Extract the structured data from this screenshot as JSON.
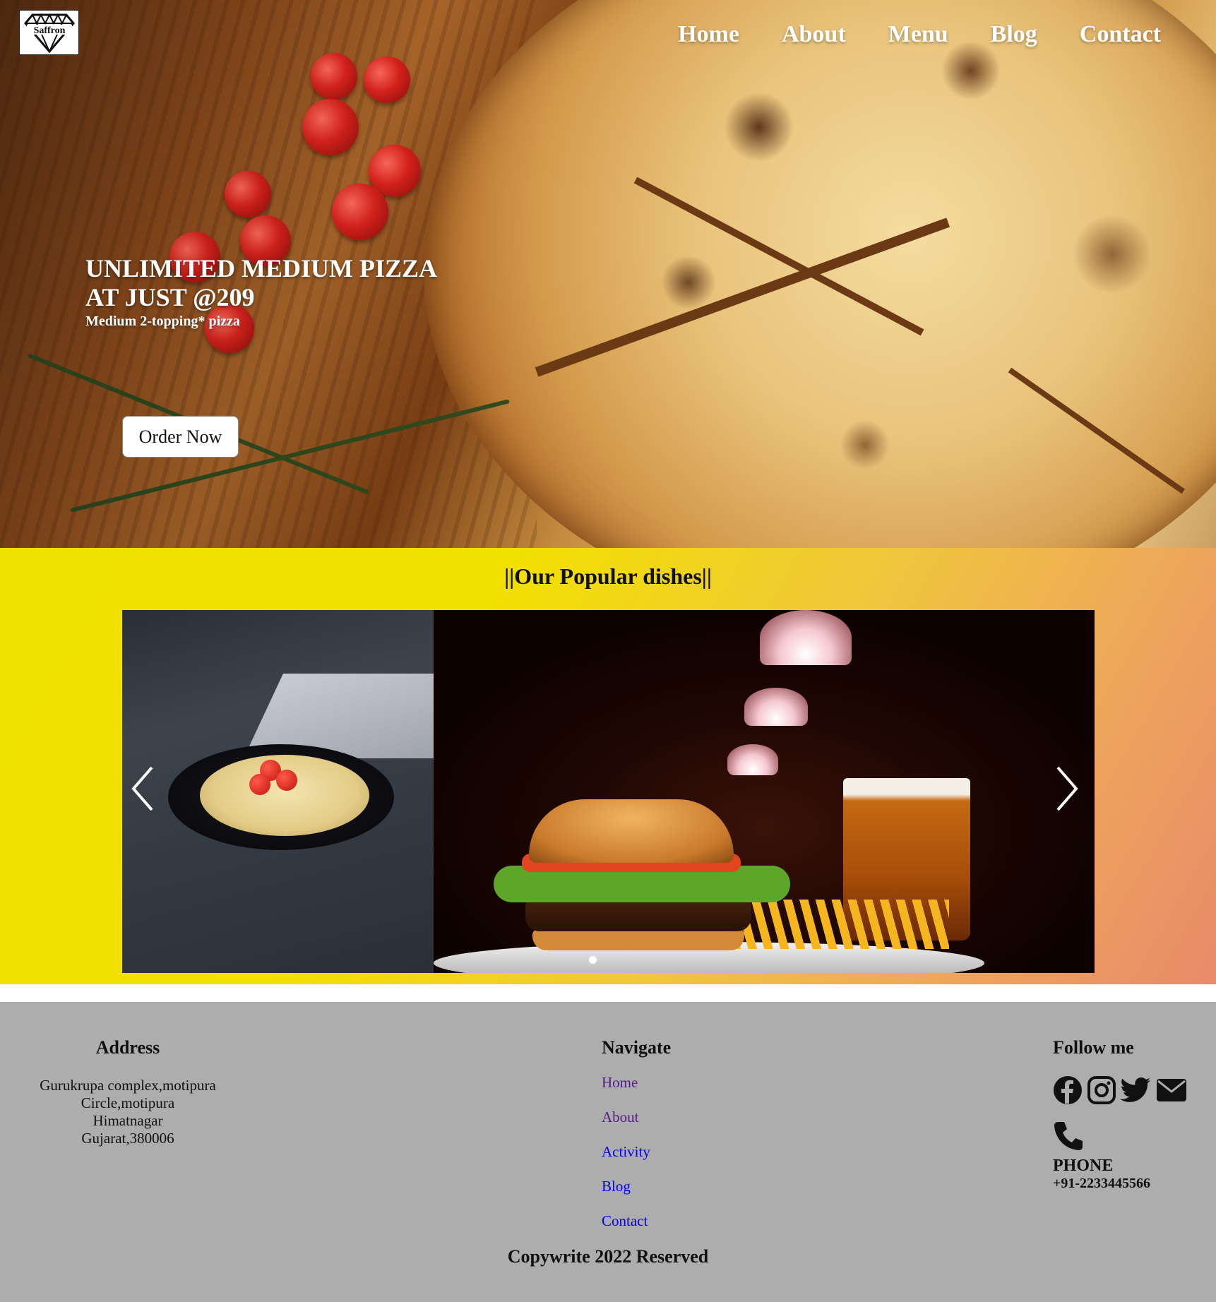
{
  "logo": {
    "text": "Saffron",
    "icon": "diamond-icon"
  },
  "nav": {
    "items": [
      {
        "label": "Home"
      },
      {
        "label": "About"
      },
      {
        "label": "Menu"
      },
      {
        "label": "Blog"
      },
      {
        "label": "Contact"
      }
    ]
  },
  "hero": {
    "title_line1": "UNLIMITED MEDIUM PIZZA",
    "title_line2": "AT JUST @209",
    "subtitle": "Medium 2-topping* pizza",
    "button_label": "Order Now"
  },
  "popular": {
    "title": "||Our Popular dishes||",
    "prev_icon": "chevron-left-icon",
    "next_icon": "chevron-right-icon"
  },
  "footer": {
    "address": {
      "title": "Address",
      "lines": [
        "Gurukrupa complex,motipura",
        "Circle,motipura",
        "Himatnagar",
        "Gujarat,380006"
      ]
    },
    "navigate": {
      "title": "Navigate",
      "links": [
        {
          "label": "Home"
        },
        {
          "label": "About"
        },
        {
          "label": "Activity"
        },
        {
          "label": "Blog"
        },
        {
          "label": "Contact"
        }
      ]
    },
    "follow": {
      "title": "Follow me",
      "icons": [
        "facebook-icon",
        "instagram-icon",
        "twitter-icon",
        "mail-icon"
      ],
      "phone_icon": "phone-icon",
      "phone_label": "PHONE",
      "phone_number": "+91-2233445566"
    },
    "copyright": "Copywrite 2022 Reserved"
  },
  "colors": {
    "footer_bg": "#adadad",
    "popular_gradient_start": "#f0e200",
    "popular_gradient_end": "#e98a6a",
    "link_visited": "#551a8b",
    "link_unvisited": "#0000ee"
  }
}
